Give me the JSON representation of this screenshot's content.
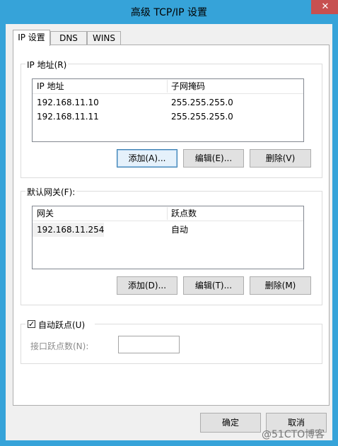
{
  "window": {
    "title": "高级 TCP/IP 设置",
    "close_glyph": "✕"
  },
  "tabs": [
    {
      "label": "IP 设置",
      "active": true
    },
    {
      "label": "DNS",
      "active": false
    },
    {
      "label": "WINS",
      "active": false
    }
  ],
  "ip_group": {
    "title": "IP 地址(R)",
    "columns": [
      "IP 地址",
      "子网掩码"
    ],
    "rows": [
      {
        "ip": "192.168.11.10",
        "mask": "255.255.255.0"
      },
      {
        "ip": "192.168.11.11",
        "mask": "255.255.255.0"
      }
    ],
    "buttons": {
      "add": "添加(A)...",
      "edit": "编辑(E)...",
      "delete": "删除(V)"
    }
  },
  "gateway_group": {
    "title": "默认网关(F):",
    "columns": [
      "网关",
      "跃点数"
    ],
    "rows": [
      {
        "gateway": "192.168.11.254",
        "metric": "自动"
      }
    ],
    "buttons": {
      "add": "添加(D)...",
      "edit": "编辑(T)...",
      "delete": "删除(M)"
    }
  },
  "metric_group": {
    "checkbox_label": "自动跃点(U)",
    "checkbox_checked": true,
    "check_glyph": "✓",
    "interface_metric_label": "接口跃点数(N):",
    "interface_metric_value": ""
  },
  "footer": {
    "ok": "确定",
    "cancel": "取消"
  },
  "watermark": "@51CTO博客"
}
